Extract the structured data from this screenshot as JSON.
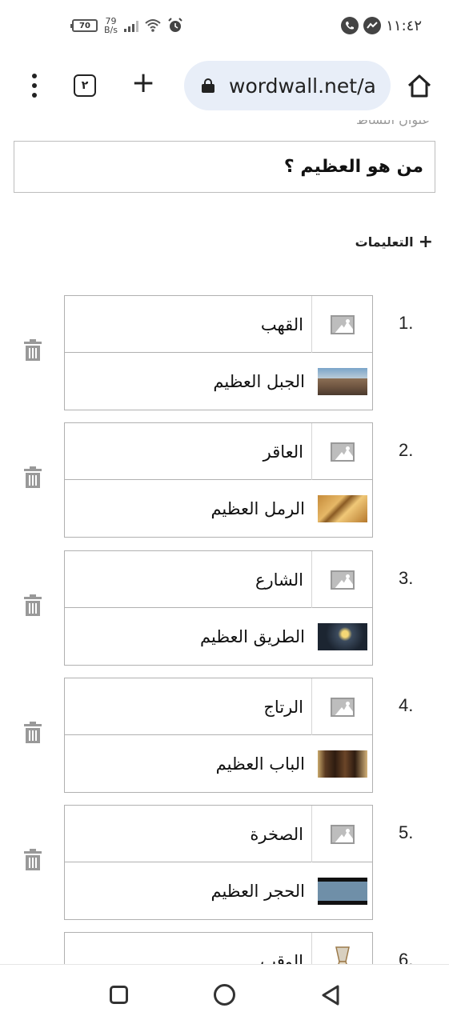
{
  "status_bar": {
    "battery": "70",
    "speed_value": "79",
    "speed_unit": "B/s",
    "time": "١١:٤٢",
    "icons": [
      "battery-icon",
      "signal-icon",
      "wifi-icon",
      "alarm-icon",
      "phone-icon",
      "messenger-icon"
    ]
  },
  "browser": {
    "tabs_count": "٢",
    "url": "wordwall.net/a"
  },
  "page": {
    "cut_label": "عنوان النشاط",
    "title_value": "من هو العظيم ؟",
    "instructions_label": "التعليمات",
    "items": [
      {
        "number": "1.",
        "keyword": "القهب",
        "definition": "الجبل العظيم",
        "thumb": "mountain"
      },
      {
        "number": "2.",
        "keyword": "العاقر",
        "definition": "الرمل العظيم",
        "thumb": "sand"
      },
      {
        "number": "3.",
        "keyword": "الشارع",
        "definition": "الطريق العظيم",
        "thumb": "road"
      },
      {
        "number": "4.",
        "keyword": "الرتاج",
        "definition": "الباب العظيم",
        "thumb": "door"
      },
      {
        "number": "5.",
        "keyword": "الصخرة",
        "definition": "الحجر العظيم",
        "thumb": "stone"
      },
      {
        "number": "6.",
        "keyword": "الوقب",
        "definition": "",
        "thumb": "glass"
      }
    ]
  },
  "nav": {
    "icons": [
      "recent-apps-icon",
      "home-circle-icon",
      "back-triangle-icon"
    ]
  }
}
